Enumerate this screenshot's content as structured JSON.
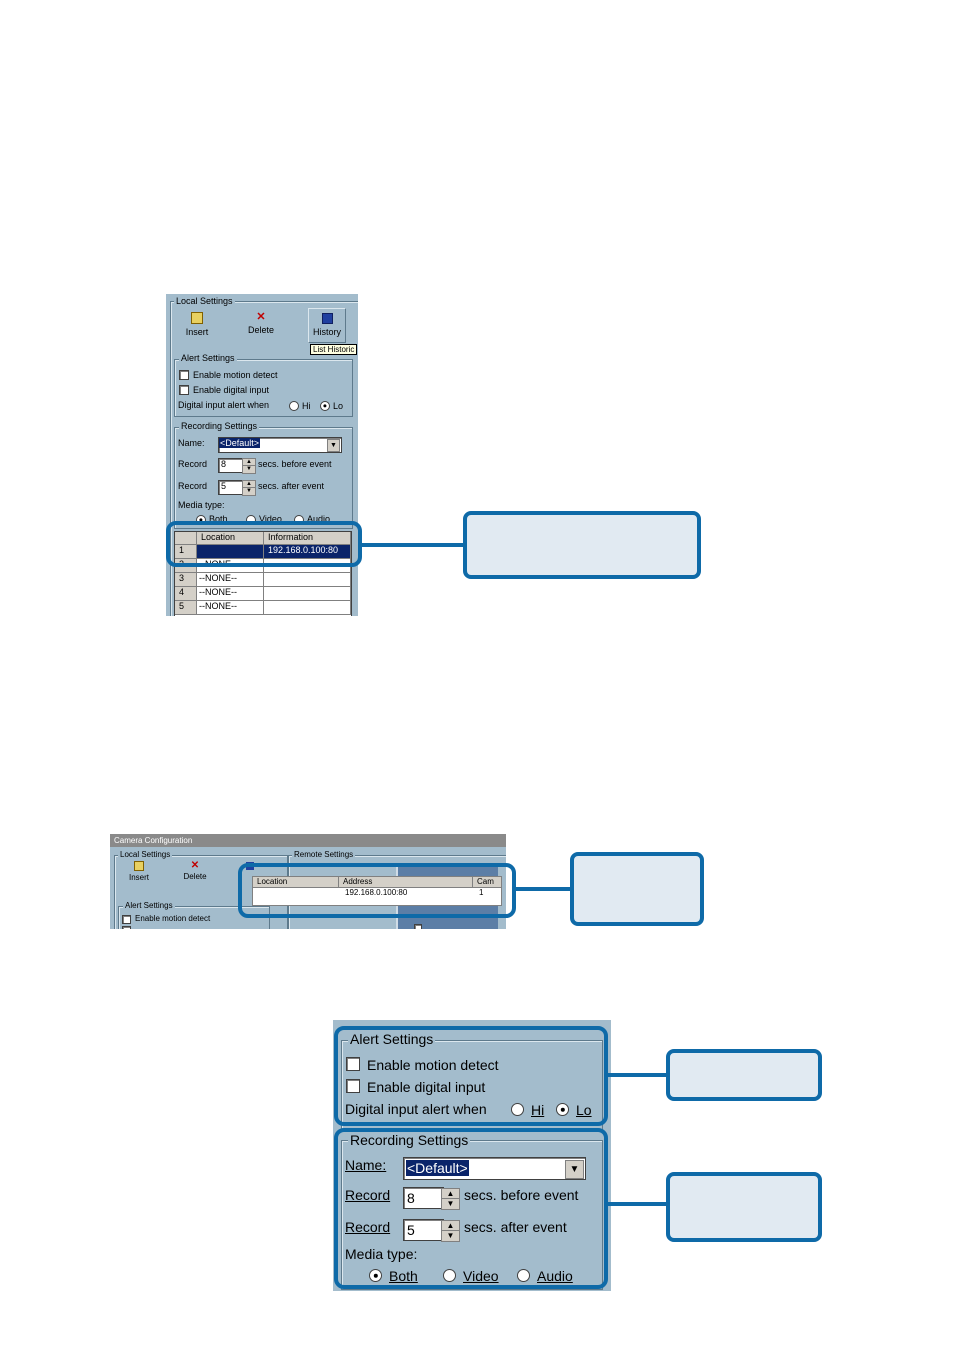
{
  "shot1": {
    "local_settings_title": "Local Settings",
    "toolbar": {
      "insert": "Insert",
      "delete": "Delete",
      "history": "History",
      "tooltip": "List Historic"
    },
    "alert_title": "Alert Settings",
    "enable_motion": "Enable motion detect",
    "enable_digital": "Enable digital input",
    "digital_alert_when": "Digital input alert when",
    "hi": "Hi",
    "lo": "Lo",
    "recording_title": "Recording Settings",
    "name_label": "Name:",
    "name_value": "<Default>",
    "record_label": "Record",
    "record_before_value": "8",
    "secs_before": "secs. before event",
    "record_after_value": "5",
    "secs_after": "secs. after event",
    "media_type": "Media type:",
    "both": "Both",
    "video": "Video",
    "audio": "Audio",
    "grid_headers": [
      "Location",
      "Information"
    ],
    "grid_rows": [
      {
        "num": "1",
        "location": "",
        "info": "192.168.0.100:80"
      },
      {
        "num": "2",
        "location": "--NONE--",
        "info": ""
      },
      {
        "num": "3",
        "location": "--NONE--",
        "info": ""
      },
      {
        "num": "4",
        "location": "--NONE--",
        "info": ""
      },
      {
        "num": "5",
        "location": "--NONE--",
        "info": ""
      }
    ]
  },
  "shot2": {
    "window_title": "Camera Configuration",
    "local_settings_title": "Local Settings",
    "remote_settings_title": "Remote Settings",
    "insert": "Insert",
    "delete": "Delete",
    "alert_title": "Alert Settings",
    "enable_motion": "Enable motion detect",
    "headers": [
      "Location",
      "Address",
      "Cam"
    ],
    "row": {
      "location": "",
      "address": "192.168.0.100:80",
      "cam": "1"
    }
  },
  "shot3": {
    "alert_title": "Alert Settings",
    "enable_motion": "Enable motion detect",
    "enable_digital": "Enable digital input",
    "digital_alert_when": "Digital input alert when",
    "hi": "Hi",
    "lo": "Lo",
    "recording_title": "Recording Settings",
    "name_label": "Name:",
    "name_value": "<Default>",
    "record_label": "Record",
    "record_before_value": "8",
    "secs_before": "secs. before event",
    "record_after_value": "5",
    "secs_after": "secs. after event",
    "media_type": "Media type:",
    "both": "Both",
    "video": "Video",
    "audio": "Audio"
  },
  "colors": {
    "accent": "#0e6aa8",
    "callout_fill": "#e1eaf2",
    "panel": "#a3bccc",
    "selection": "#0a246a"
  }
}
